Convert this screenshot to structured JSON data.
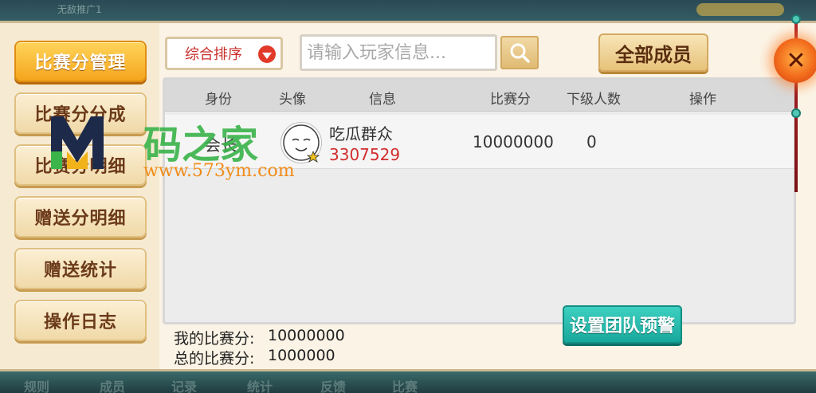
{
  "background": {
    "top_ghost_text": "无敌推广1",
    "bottom_tabs": [
      "规则",
      "成员",
      "记录",
      "统计",
      "反馈",
      "比赛"
    ]
  },
  "sidebar": {
    "items": [
      {
        "label": "比赛分管理",
        "active": true
      },
      {
        "label": "比赛分分成",
        "active": false
      },
      {
        "label": "比赛分明细",
        "active": false
      },
      {
        "label": "赠送分明细",
        "active": false
      },
      {
        "label": "赠送统计",
        "active": false
      },
      {
        "label": "操作日志",
        "active": false
      }
    ]
  },
  "toolbar": {
    "sort_label": "综合排序",
    "search_placeholder": "请输入玩家信息...",
    "search_icon": "search-icon",
    "all_members_label": "全部成员"
  },
  "table": {
    "headers": [
      "身份",
      "头像",
      "信息",
      "比赛分",
      "下级人数",
      "操作"
    ],
    "rows": [
      {
        "role": "会长",
        "name": "吃瓜群众",
        "id": "3307529",
        "score": "10000000",
        "subordinates": "0",
        "action": ""
      }
    ]
  },
  "footer": {
    "my_score_label": "我的比赛分:",
    "my_score_value": "10000000",
    "total_score_label": "总的比赛分:",
    "total_score_value": "1000000",
    "warn_button_label": "设置团队预警"
  },
  "close_label": "✕",
  "watermark": {
    "text": "码之家",
    "url": "www.573ym.com"
  },
  "colors": {
    "accent_orange": "#f5a51c",
    "teal_button": "#17a89c",
    "id_red": "#d22e2e",
    "panel_bg": "#fbf4e6"
  }
}
